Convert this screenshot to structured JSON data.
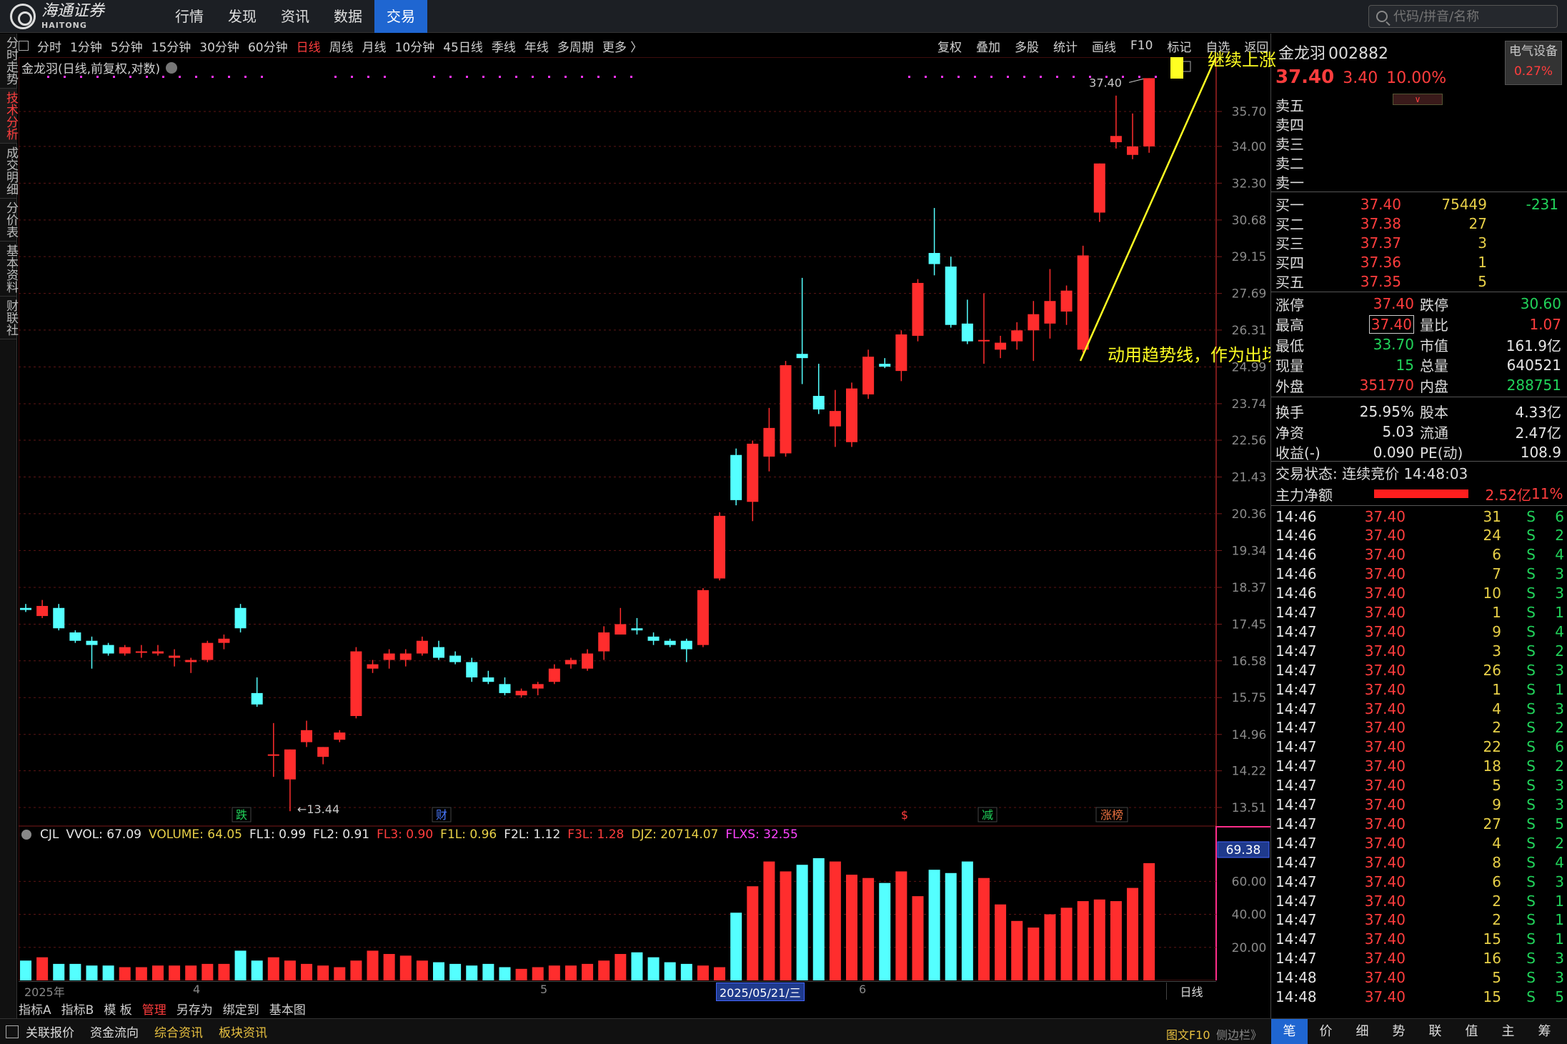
{
  "brand": {
    "cn": "海通证券",
    "en": "HAITONG"
  },
  "nav": [
    "行情",
    "发现",
    "资讯",
    "数据",
    "交易"
  ],
  "nav_active": 4,
  "search": {
    "placeholder": "代码/拼音/名称"
  },
  "left_tabs": [
    "分时走势",
    "技术分析",
    "成交明细",
    "分价表",
    "基本资料",
    "财联社"
  ],
  "left_tab_active": 1,
  "periods": [
    "分时",
    "1分钟",
    "5分钟",
    "15分钟",
    "30分钟",
    "60分钟",
    "日线",
    "周线",
    "月线",
    "10分钟",
    "45日线",
    "季线",
    "年线",
    "多周期",
    "更多 〉"
  ],
  "period_active": 6,
  "right_tools": [
    "复权",
    "叠加",
    "多股",
    "统计",
    "画线",
    "F10",
    "标记",
    "自选",
    "返回"
  ],
  "chart_title": "金龙羽(日线,前复权,对数)",
  "price_axis": [
    "35.70",
    "34.00",
    "32.30",
    "30.68",
    "29.15",
    "27.69",
    "26.31",
    "24.99",
    "23.74",
    "22.56",
    "21.43",
    "20.36",
    "19.34",
    "18.37",
    "17.45",
    "16.58",
    "15.75",
    "14.96",
    "14.22",
    "13.51"
  ],
  "annotations": {
    "high_label": "37.40",
    "low_label": "13.44",
    "trend_text": "动用趋势线，作为出场方式",
    "trend_top_text": "继续上涨",
    "events": [
      "跌",
      "财",
      "$",
      "减",
      "涨榜"
    ]
  },
  "volume_info": {
    "name": "CJL",
    "items": [
      {
        "text": "VVOL: 67.09",
        "color": "#e6e6e6"
      },
      {
        "text": "VOLUME: 64.05",
        "color": "#e8d048"
      },
      {
        "text": "FL1: 0.99",
        "color": "#e6e6e6"
      },
      {
        "text": "FL2: 0.91",
        "color": "#e6e6e6"
      },
      {
        "text": "FL3: 0.90",
        "color": "#ff3d3d"
      },
      {
        "text": "F1L: 0.96",
        "color": "#e8d048"
      },
      {
        "text": "F2L: 1.12",
        "color": "#e6e6e6"
      },
      {
        "text": "F3L: 1.28",
        "color": "#ff3d3d"
      },
      {
        "text": "DJZ: 20714.07",
        "color": "#e8d048"
      },
      {
        "text": "FLXS: 32.55",
        "color": "#ff44ff"
      }
    ],
    "axis": [
      "60.00",
      "40.00",
      "20.00"
    ],
    "current_label": "69.38"
  },
  "xaxis": {
    "labels": [
      "2025年",
      "4",
      "5",
      "2025/05/21/三",
      "6"
    ],
    "period_label": "日线"
  },
  "indicator_tabs": [
    "指标A",
    "指标B",
    "模 板",
    "管理",
    "另存为",
    "绑定到",
    "基本图"
  ],
  "indicator_active": 3,
  "bottom_links": [
    "关联报价",
    "资金流向",
    "综合资讯",
    "板块资讯"
  ],
  "bottom_right": [
    "图文F10",
    "侧边栏》"
  ],
  "bottom_tabs": [
    "笔",
    "价",
    "细",
    "势",
    "联",
    "值",
    "主",
    "筹"
  ],
  "quote": {
    "name": "金龙羽",
    "code": "002882",
    "price": "37.40",
    "change": "3.40",
    "change_pct": "10.00%",
    "sector": "电气设备",
    "sector_pct": "0.27%"
  },
  "order_book": {
    "sell": [
      "卖五",
      "卖四",
      "卖三",
      "卖二",
      "卖一"
    ],
    "buy": [
      {
        "label": "买一",
        "price": "37.40",
        "volume": "75449",
        "change": "-231"
      },
      {
        "label": "买二",
        "price": "37.38",
        "volume": "27",
        "change": ""
      },
      {
        "label": "买三",
        "price": "37.37",
        "volume": "3",
        "change": ""
      },
      {
        "label": "买四",
        "price": "37.36",
        "volume": "1",
        "change": ""
      },
      {
        "label": "买五",
        "price": "37.35",
        "volume": "5",
        "change": ""
      }
    ]
  },
  "stats": [
    {
      "k1": "涨停",
      "v1": "37.40",
      "c1": "red",
      "k2": "跌停",
      "v2": "30.60",
      "c2": "green"
    },
    {
      "k1": "最高",
      "v1": "37.40",
      "c1": "red",
      "k2": "量比",
      "v2": "1.07",
      "c2": "red"
    },
    {
      "k1": "最低",
      "v1": "33.70",
      "c1": "green",
      "k2": "市值",
      "v2": "161.9亿",
      "c2": "white"
    },
    {
      "k1": "现量",
      "v1": "15",
      "c1": "green",
      "k2": "总量",
      "v2": "640521",
      "c2": "white"
    },
    {
      "k1": "外盘",
      "v1": "351770",
      "c1": "red",
      "k2": "内盘",
      "v2": "288751",
      "c2": "green"
    },
    {
      "k1": "换手",
      "v1": "25.95%",
      "c1": "white",
      "k2": "股本",
      "v2": "4.33亿",
      "c2": "white"
    },
    {
      "k1": "净资",
      "v1": "5.03",
      "c1": "white",
      "k2": "流通",
      "v2": "2.47亿",
      "c2": "white"
    },
    {
      "k1": "收益(-)",
      "v1": "0.090",
      "c1": "white",
      "k2": "PE(动)",
      "v2": "108.9",
      "c2": "white"
    }
  ],
  "trade_state": "交易状态: 连续竞价 14:48:03",
  "main_flow": {
    "label": "主力净额",
    "value": "2.52亿",
    "pct": "11%"
  },
  "ticks": [
    {
      "t": "14:46",
      "p": "37.40",
      "v": "31",
      "bs": "S",
      "n": "6"
    },
    {
      "t": "14:46",
      "p": "37.40",
      "v": "24",
      "bs": "S",
      "n": "2"
    },
    {
      "t": "14:46",
      "p": "37.40",
      "v": "6",
      "bs": "S",
      "n": "4"
    },
    {
      "t": "14:46",
      "p": "37.40",
      "v": "7",
      "bs": "S",
      "n": "3"
    },
    {
      "t": "14:46",
      "p": "37.40",
      "v": "10",
      "bs": "S",
      "n": "3"
    },
    {
      "t": "14:47",
      "p": "37.40",
      "v": "1",
      "bs": "S",
      "n": "1"
    },
    {
      "t": "14:47",
      "p": "37.40",
      "v": "9",
      "bs": "S",
      "n": "4"
    },
    {
      "t": "14:47",
      "p": "37.40",
      "v": "3",
      "bs": "S",
      "n": "2"
    },
    {
      "t": "14:47",
      "p": "37.40",
      "v": "26",
      "bs": "S",
      "n": "3"
    },
    {
      "t": "14:47",
      "p": "37.40",
      "v": "1",
      "bs": "S",
      "n": "1"
    },
    {
      "t": "14:47",
      "p": "37.40",
      "v": "4",
      "bs": "S",
      "n": "3"
    },
    {
      "t": "14:47",
      "p": "37.40",
      "v": "2",
      "bs": "S",
      "n": "2"
    },
    {
      "t": "14:47",
      "p": "37.40",
      "v": "22",
      "bs": "S",
      "n": "6"
    },
    {
      "t": "14:47",
      "p": "37.40",
      "v": "18",
      "bs": "S",
      "n": "2"
    },
    {
      "t": "14:47",
      "p": "37.40",
      "v": "5",
      "bs": "S",
      "n": "3"
    },
    {
      "t": "14:47",
      "p": "37.40",
      "v": "9",
      "bs": "S",
      "n": "3"
    },
    {
      "t": "14:47",
      "p": "37.40",
      "v": "27",
      "bs": "S",
      "n": "5"
    },
    {
      "t": "14:47",
      "p": "37.40",
      "v": "4",
      "bs": "S",
      "n": "2"
    },
    {
      "t": "14:47",
      "p": "37.40",
      "v": "8",
      "bs": "S",
      "n": "4"
    },
    {
      "t": "14:47",
      "p": "37.40",
      "v": "6",
      "bs": "S",
      "n": "3"
    },
    {
      "t": "14:47",
      "p": "37.40",
      "v": "2",
      "bs": "S",
      "n": "1"
    },
    {
      "t": "14:47",
      "p": "37.40",
      "v": "2",
      "bs": "S",
      "n": "1"
    },
    {
      "t": "14:47",
      "p": "37.40",
      "v": "15",
      "bs": "S",
      "n": "1"
    },
    {
      "t": "14:47",
      "p": "37.40",
      "v": "16",
      "bs": "S",
      "n": "3"
    },
    {
      "t": "14:48",
      "p": "37.40",
      "v": "5",
      "bs": "S",
      "n": "3"
    },
    {
      "t": "14:48",
      "p": "37.40",
      "v": "15",
      "bs": "S",
      "n": "5"
    }
  ],
  "colors": {
    "up": "#ff2d2d",
    "down": "#54ffff",
    "grid": "#7a1a1a",
    "accent": "#1f66d1",
    "trend": "#ffff22"
  },
  "chart_data": {
    "type": "candlestick",
    "title": "金龙羽(日线,前复权,对数)",
    "scale": "log",
    "ylim": [
      13.2,
      38.2
    ],
    "candles": [
      [
        17.85,
        17.95,
        17.75,
        17.8
      ],
      [
        17.65,
        18.05,
        17.6,
        17.9
      ],
      [
        17.85,
        17.95,
        17.3,
        17.35
      ],
      [
        17.25,
        17.3,
        17.0,
        17.05
      ],
      [
        17.05,
        17.15,
        16.4,
        16.95
      ],
      [
        16.95,
        17.0,
        16.7,
        16.75
      ],
      [
        16.75,
        16.95,
        16.7,
        16.9
      ],
      [
        16.8,
        16.95,
        16.65,
        16.8
      ],
      [
        16.75,
        16.95,
        16.7,
        16.8
      ],
      [
        16.65,
        16.85,
        16.45,
        16.7
      ],
      [
        16.55,
        16.65,
        16.3,
        16.6
      ],
      [
        16.6,
        17.05,
        16.55,
        17.0
      ],
      [
        17.0,
        17.2,
        16.85,
        17.1
      ],
      [
        17.85,
        17.95,
        17.25,
        17.35
      ],
      [
        15.85,
        16.2,
        15.55,
        15.6
      ],
      [
        14.55,
        15.2,
        14.1,
        14.55
      ],
      [
        14.05,
        14.65,
        13.44,
        14.65
      ],
      [
        14.8,
        15.25,
        14.7,
        15.05
      ],
      [
        14.5,
        14.7,
        14.35,
        14.7
      ],
      [
        14.85,
        15.05,
        14.8,
        15.0
      ],
      [
        15.35,
        16.9,
        15.3,
        16.8
      ],
      [
        16.4,
        16.6,
        16.3,
        16.5
      ],
      [
        16.6,
        16.85,
        16.4,
        16.75
      ],
      [
        16.6,
        16.85,
        16.45,
        16.75
      ],
      [
        16.75,
        17.15,
        16.7,
        17.05
      ],
      [
        16.9,
        17.05,
        16.6,
        16.65
      ],
      [
        16.7,
        16.8,
        16.5,
        16.55
      ],
      [
        16.55,
        16.65,
        16.1,
        16.2
      ],
      [
        16.2,
        16.35,
        16.05,
        16.1
      ],
      [
        16.05,
        16.2,
        15.8,
        15.85
      ],
      [
        15.8,
        15.95,
        15.75,
        15.9
      ],
      [
        15.95,
        16.1,
        15.8,
        16.05
      ],
      [
        16.1,
        16.5,
        16.05,
        16.4
      ],
      [
        16.5,
        16.65,
        16.4,
        16.6
      ],
      [
        16.4,
        16.85,
        16.35,
        16.75
      ],
      [
        16.8,
        17.4,
        16.6,
        17.25
      ],
      [
        17.2,
        17.85,
        17.2,
        17.45
      ],
      [
        17.35,
        17.6,
        17.2,
        17.3
      ],
      [
        17.15,
        17.25,
        16.95,
        17.05
      ],
      [
        17.05,
        17.1,
        16.9,
        16.95
      ],
      [
        17.05,
        17.1,
        16.55,
        16.85
      ],
      [
        16.95,
        18.35,
        16.9,
        18.3
      ],
      [
        18.6,
        20.4,
        18.55,
        20.3
      ],
      [
        22.1,
        22.3,
        20.6,
        20.75
      ],
      [
        20.7,
        22.55,
        20.15,
        22.45
      ],
      [
        22.05,
        23.6,
        21.6,
        22.95
      ],
      [
        22.15,
        25.2,
        22.05,
        25.05
      ],
      [
        25.45,
        28.3,
        24.4,
        25.3
      ],
      [
        24.0,
        25.1,
        23.4,
        23.55
      ],
      [
        23.0,
        24.2,
        22.35,
        23.5
      ],
      [
        22.5,
        24.45,
        22.35,
        24.25
      ],
      [
        24.05,
        25.6,
        23.9,
        25.35
      ],
      [
        25.1,
        25.3,
        24.95,
        25.0
      ],
      [
        24.85,
        26.3,
        24.5,
        26.15
      ],
      [
        26.1,
        28.25,
        25.9,
        28.1
      ],
      [
        29.3,
        31.2,
        28.4,
        28.85
      ],
      [
        28.75,
        29.15,
        26.4,
        26.5
      ],
      [
        26.55,
        27.45,
        25.8,
        25.9
      ],
      [
        25.9,
        27.7,
        25.1,
        25.95
      ],
      [
        25.6,
        26.1,
        25.3,
        25.85
      ],
      [
        25.9,
        26.6,
        25.6,
        26.3
      ],
      [
        26.3,
        27.4,
        25.2,
        26.9
      ],
      [
        26.55,
        28.65,
        26.0,
        27.4
      ],
      [
        27.0,
        28.0,
        26.5,
        27.8
      ],
      [
        25.6,
        29.6,
        25.5,
        29.2
      ],
      [
        31.0,
        33.2,
        30.6,
        33.2
      ],
      [
        34.2,
        36.5,
        33.9,
        34.5
      ],
      [
        33.6,
        35.6,
        33.4,
        34.0
      ],
      [
        34.0,
        37.4,
        33.7,
        37.4
      ]
    ],
    "volume": [
      12,
      14,
      10,
      10,
      9,
      9,
      8,
      8,
      9,
      9,
      9,
      10,
      10,
      18,
      12,
      14,
      12,
      10,
      9,
      8,
      12,
      18,
      16,
      15,
      12,
      11,
      10,
      9,
      10,
      8,
      7,
      8,
      9,
      9,
      10,
      12,
      16,
      17,
      14,
      11,
      10,
      9,
      8,
      41,
      57,
      72,
      66,
      70,
      74,
      72,
      64,
      62,
      59,
      66,
      51,
      67,
      65,
      72,
      62,
      46,
      36,
      32,
      40,
      44,
      48,
      49,
      48,
      56,
      71,
      69,
      64,
      64
    ]
  }
}
